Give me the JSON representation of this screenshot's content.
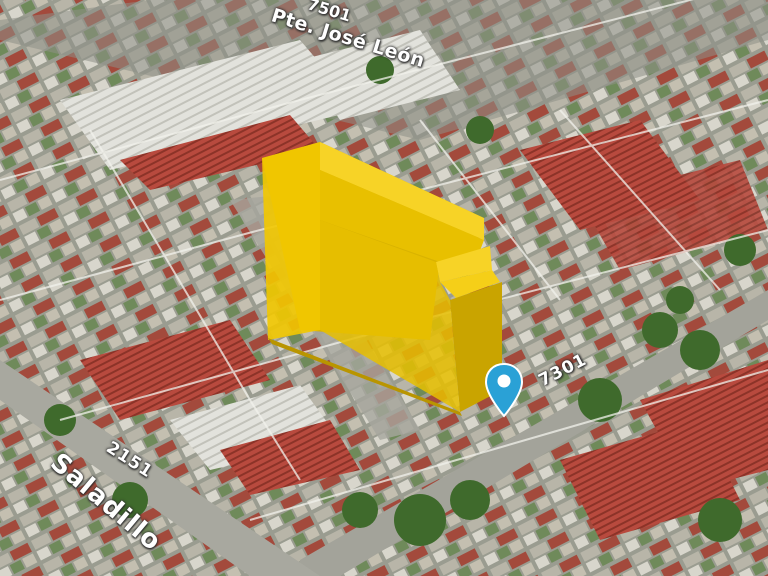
{
  "map": {
    "view": "3d-satellite",
    "street_labels": {
      "top_street": "Pte. José León",
      "top_number": "7501",
      "right_number": "7301",
      "bottom_number": "2151",
      "bottom_street": "Saladillo"
    },
    "pin": {
      "icon": "location-pin-icon",
      "color": "#2aa1d6"
    },
    "building_highlight": {
      "color": "#f2c800"
    }
  }
}
